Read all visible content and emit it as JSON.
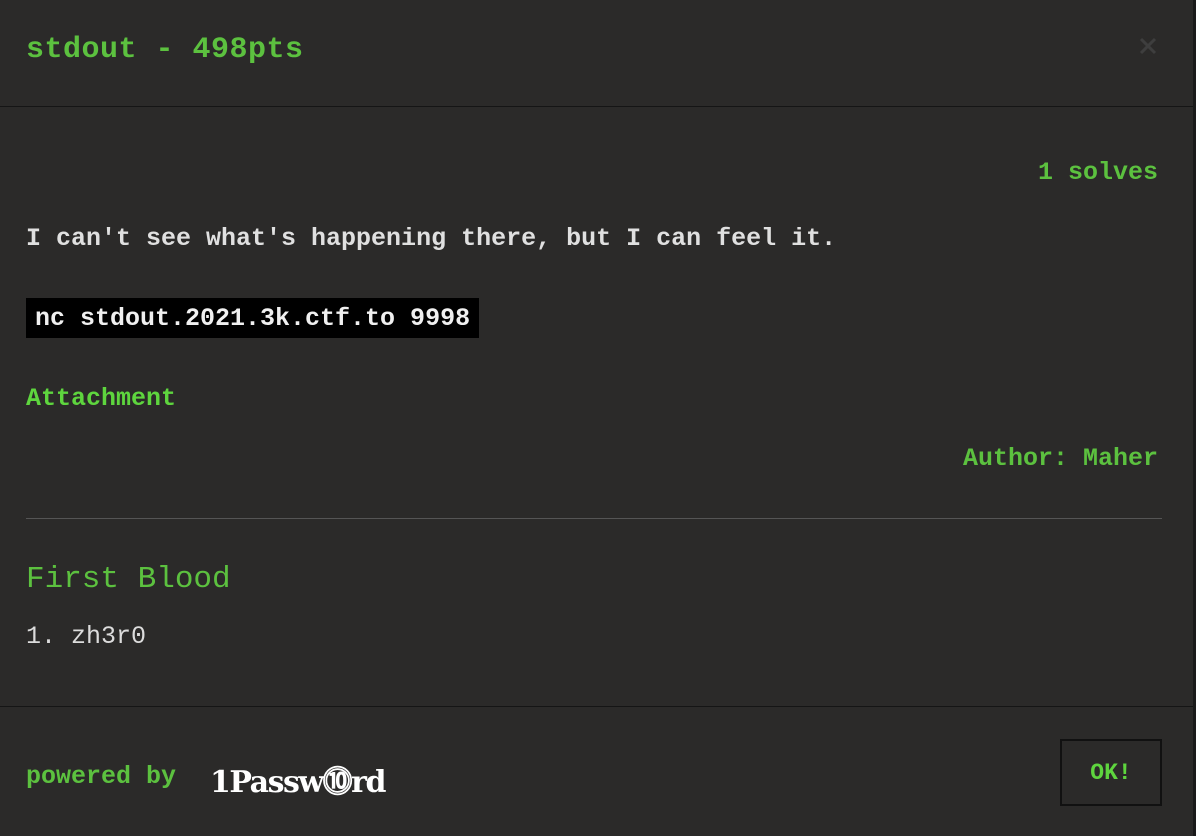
{
  "modal": {
    "title": "stdout - 498pts",
    "close_icon": "close-icon",
    "solves": "1 solves",
    "description": "I can't see what's happening there, but I can feel it.",
    "command": "nc stdout.2021.3k.ctf.to 9998",
    "attachment_label": "Attachment",
    "author": "Author: Maher"
  },
  "first_blood": {
    "heading": "First Blood",
    "entries": [
      "1. zh3r0"
    ]
  },
  "footer": {
    "powered_by": "powered by",
    "brand": "1Passw⓾rd",
    "ok_label": "OK!"
  },
  "colors": {
    "background": "#2b2a29",
    "accent": "#5cc13f",
    "code_background": "#000000"
  }
}
